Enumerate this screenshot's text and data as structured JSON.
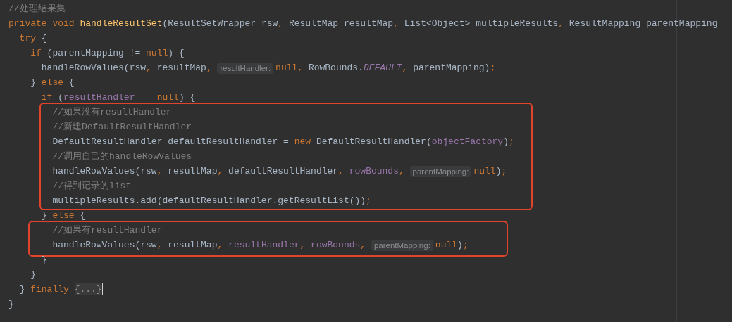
{
  "editor": {
    "segments": [
      {
        "framed": false,
        "lines": [
          {
            "tokens": [
              {
                "kind": "comment",
                "text": "//处理结果集"
              }
            ]
          },
          {
            "tokens": [
              {
                "kind": "keyword",
                "text": "private void "
              },
              {
                "kind": "method",
                "text": "handleResultSet"
              },
              {
                "kind": "plain",
                "text": "(ResultSetWrapper rsw"
              },
              {
                "kind": "punct",
                "text": ","
              },
              {
                "kind": "plain",
                "text": " ResultMap resultMap"
              },
              {
                "kind": "punct",
                "text": ","
              },
              {
                "kind": "plain",
                "text": " List<Object> multipleResults"
              },
              {
                "kind": "punct",
                "text": ","
              },
              {
                "kind": "plain",
                "text": " ResultMapping parentMapping"
              }
            ]
          },
          {
            "tokens": [
              {
                "kind": "keyword",
                "text": "  try"
              },
              {
                "kind": "plain",
                "text": " {"
              }
            ]
          },
          {
            "tokens": [
              {
                "kind": "keyword",
                "text": "    if"
              },
              {
                "kind": "plain",
                "text": " (parentMapping != "
              },
              {
                "kind": "keyword",
                "text": "null"
              },
              {
                "kind": "plain",
                "text": ") {"
              }
            ]
          },
          {
            "tokens": [
              {
                "kind": "plain",
                "text": "      handleRowValues(rsw"
              },
              {
                "kind": "punct",
                "text": ","
              },
              {
                "kind": "plain",
                "text": " resultMap"
              },
              {
                "kind": "punct",
                "text": ", "
              },
              {
                "kind": "hint",
                "text": "resultHandler:"
              },
              {
                "kind": "keyword",
                "text": "null"
              },
              {
                "kind": "punct",
                "text": ","
              },
              {
                "kind": "plain",
                "text": " RowBounds."
              },
              {
                "kind": "static",
                "text": "DEFAULT"
              },
              {
                "kind": "punct",
                "text": ","
              },
              {
                "kind": "plain",
                "text": " parentMapping)"
              },
              {
                "kind": "punct",
                "text": ";"
              }
            ]
          },
          {
            "tokens": [
              {
                "kind": "plain",
                "text": "    } "
              },
              {
                "kind": "keyword",
                "text": "else"
              },
              {
                "kind": "plain",
                "text": " {"
              }
            ]
          },
          {
            "tokens": [
              {
                "kind": "keyword",
                "text": "      if"
              },
              {
                "kind": "plain",
                "text": " ("
              },
              {
                "kind": "field",
                "text": "resultHandler"
              },
              {
                "kind": "plain",
                "text": " == "
              },
              {
                "kind": "keyword",
                "text": "null"
              },
              {
                "kind": "plain",
                "text": ") {"
              }
            ]
          }
        ]
      },
      {
        "framed": true,
        "lines": [
          {
            "tokens": [
              {
                "kind": "comment",
                "text": "        //如果没有resultHandler"
              }
            ]
          },
          {
            "tokens": [
              {
                "kind": "comment",
                "text": "        //新建DefaultResultHandler"
              }
            ]
          },
          {
            "tokens": [
              {
                "kind": "plain",
                "text": "        DefaultResultHandler defaultResultHandler = "
              },
              {
                "kind": "keyword",
                "text": "new"
              },
              {
                "kind": "plain",
                "text": " DefaultResultHandler("
              },
              {
                "kind": "field",
                "text": "objectFactory"
              },
              {
                "kind": "plain",
                "text": ")"
              },
              {
                "kind": "punct",
                "text": ";"
              }
            ]
          },
          {
            "tokens": [
              {
                "kind": "comment",
                "text": "        //调用自己的handleRowValues"
              }
            ]
          },
          {
            "tokens": [
              {
                "kind": "plain",
                "text": "        handleRowValues(rsw"
              },
              {
                "kind": "punct",
                "text": ","
              },
              {
                "kind": "plain",
                "text": " resultMap"
              },
              {
                "kind": "punct",
                "text": ","
              },
              {
                "kind": "plain",
                "text": " defaultResultHandler"
              },
              {
                "kind": "punct",
                "text": ","
              },
              {
                "kind": "field",
                "text": " rowBounds"
              },
              {
                "kind": "punct",
                "text": ", "
              },
              {
                "kind": "hint",
                "text": "parentMapping:"
              },
              {
                "kind": "keyword",
                "text": "null"
              },
              {
                "kind": "plain",
                "text": ")"
              },
              {
                "kind": "punct",
                "text": ";"
              }
            ]
          },
          {
            "tokens": [
              {
                "kind": "comment",
                "text": "        //得到记录的list"
              }
            ]
          },
          {
            "tokens": [
              {
                "kind": "plain",
                "text": "        multipleResults.add(defaultResultHandler.getResultList())"
              },
              {
                "kind": "punct",
                "text": ";"
              }
            ]
          }
        ]
      },
      {
        "framed": false,
        "lines": [
          {
            "tokens": [
              {
                "kind": "plain",
                "text": "      } "
              },
              {
                "kind": "keyword",
                "text": "else"
              },
              {
                "kind": "plain",
                "text": " {"
              }
            ]
          }
        ]
      },
      {
        "framed": true,
        "lines": [
          {
            "tokens": [
              {
                "kind": "comment",
                "text": "        //如果有resultHandler"
              }
            ]
          },
          {
            "tokens": [
              {
                "kind": "plain",
                "text": "        handleRowValues(rsw"
              },
              {
                "kind": "punct",
                "text": ","
              },
              {
                "kind": "plain",
                "text": " resultMap"
              },
              {
                "kind": "punct",
                "text": ","
              },
              {
                "kind": "field",
                "text": " resultHandler"
              },
              {
                "kind": "punct",
                "text": ","
              },
              {
                "kind": "field",
                "text": " rowBounds"
              },
              {
                "kind": "punct",
                "text": ", "
              },
              {
                "kind": "hint",
                "text": "parentMapping:"
              },
              {
                "kind": "keyword",
                "text": "null"
              },
              {
                "kind": "plain",
                "text": ")"
              },
              {
                "kind": "punct",
                "text": ";"
              }
            ]
          }
        ]
      },
      {
        "framed": false,
        "lines": [
          {
            "tokens": [
              {
                "kind": "plain",
                "text": "      }"
              }
            ]
          },
          {
            "tokens": [
              {
                "kind": "plain",
                "text": "    }"
              }
            ]
          },
          {
            "tokens": [
              {
                "kind": "plain",
                "text": "  } "
              },
              {
                "kind": "keyword",
                "text": "finally "
              },
              {
                "kind": "fold",
                "text": "{...}"
              }
            ]
          },
          {
            "tokens": [
              {
                "kind": "plain",
                "text": "}"
              }
            ]
          }
        ]
      }
    ]
  }
}
